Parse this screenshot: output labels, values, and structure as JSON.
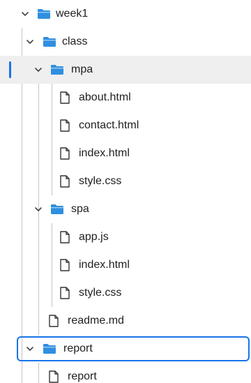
{
  "colors": {
    "folder": "#2f8fe0",
    "accent": "#1a73e8",
    "selected_bg": "#efefef"
  },
  "tree": {
    "week1": "week1",
    "class": "class",
    "mpa": {
      "name": "mpa",
      "files": [
        "about.html",
        "contact.html",
        "index.html",
        "style.css"
      ]
    },
    "spa": {
      "name": "spa",
      "files": [
        "app.js",
        "index.html",
        "style.css"
      ]
    },
    "readme": "readme.md",
    "report": {
      "name": "report",
      "files": [
        "report"
      ]
    }
  }
}
